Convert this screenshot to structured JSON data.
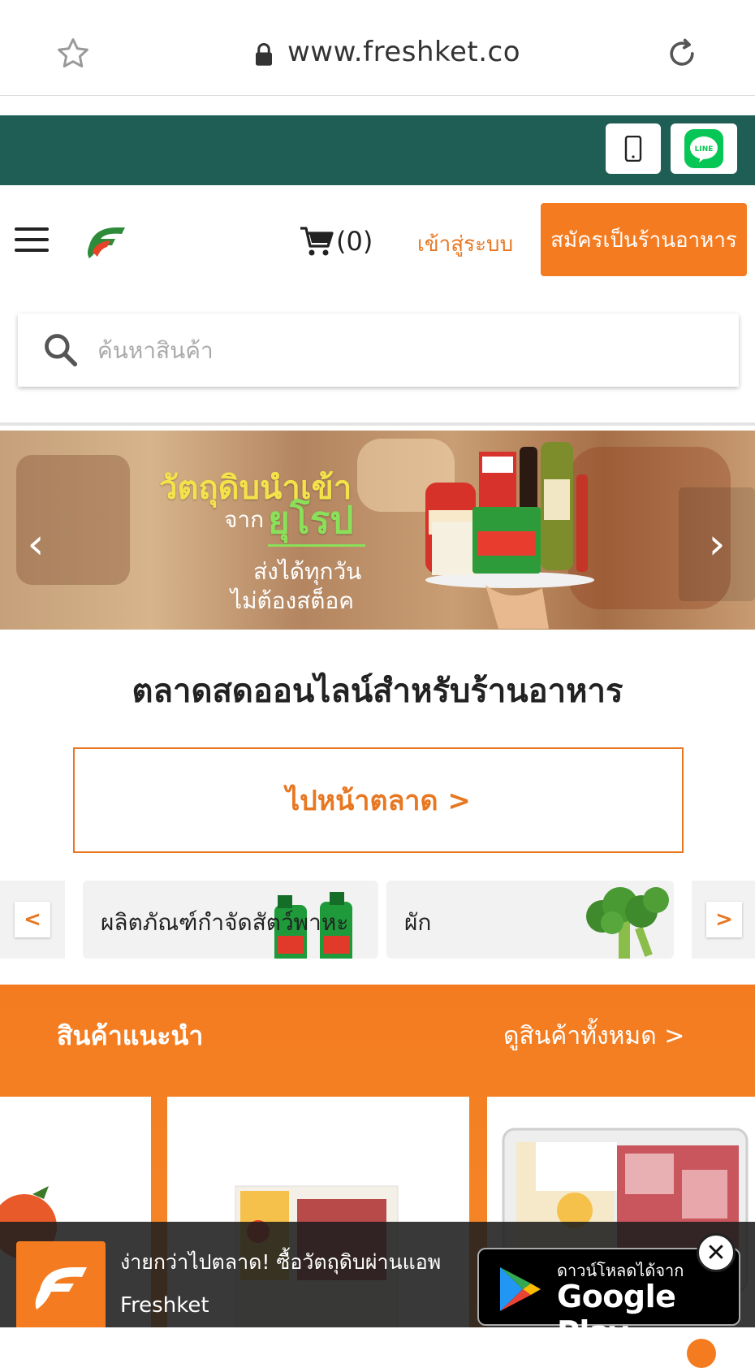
{
  "browser": {
    "url": "www.freshket.co",
    "icons": {
      "bookmark": "star-icon",
      "secure": "lock-icon",
      "reload": "reload-icon"
    }
  },
  "top_strip": {
    "background": "#1f5e55",
    "icons": {
      "phone": "phone-icon",
      "line": "line-icon"
    },
    "line_label": "LINE"
  },
  "header": {
    "menu_icon": "hamburger-icon",
    "logo_icon": "freshket-logo-icon",
    "cart_icon": "cart-icon",
    "cart_count": "(0)",
    "login_label": "เข้าสู่ระบบ",
    "register_label": "สมัครเป็นร้านอาหาร"
  },
  "search": {
    "placeholder": "ค้นหาสินค้า",
    "icon": "search-icon"
  },
  "banner": {
    "line1": "วัตถุดิบนำเข้า",
    "line2_prefix": "จาก",
    "line2_highlight": "ยุโรป",
    "line3": "ส่งได้ทุกวัน",
    "line4": "ไม่ต้องสต็อค",
    "prev": "‹",
    "next": "›"
  },
  "headline": "ตลาดสดออนไลน์สำหรับร้านอาหาร",
  "market_button": "ไปหน้าตลาด >",
  "categories": {
    "prev": "<",
    "next": ">",
    "items": [
      {
        "label": "ผลิตภัณฑ์กำจัดสัตว์พาหะ"
      },
      {
        "label": "ผัก"
      }
    ]
  },
  "recommended": {
    "title": "สินค้าแนะนำ",
    "view_all": "ดูสินค้าทั้งหมด >"
  },
  "app_banner": {
    "text": "ง่ายกว่าไปตลาด! ซื้อวัตถุดิบผ่านแอพ",
    "app_name": "Freshket",
    "store_small": "ดาวน์โหลดได้จาก",
    "store_big": "Google Play",
    "close": "✕"
  },
  "colors": {
    "accent": "#f47b20",
    "brand_green": "#1f5e55"
  }
}
